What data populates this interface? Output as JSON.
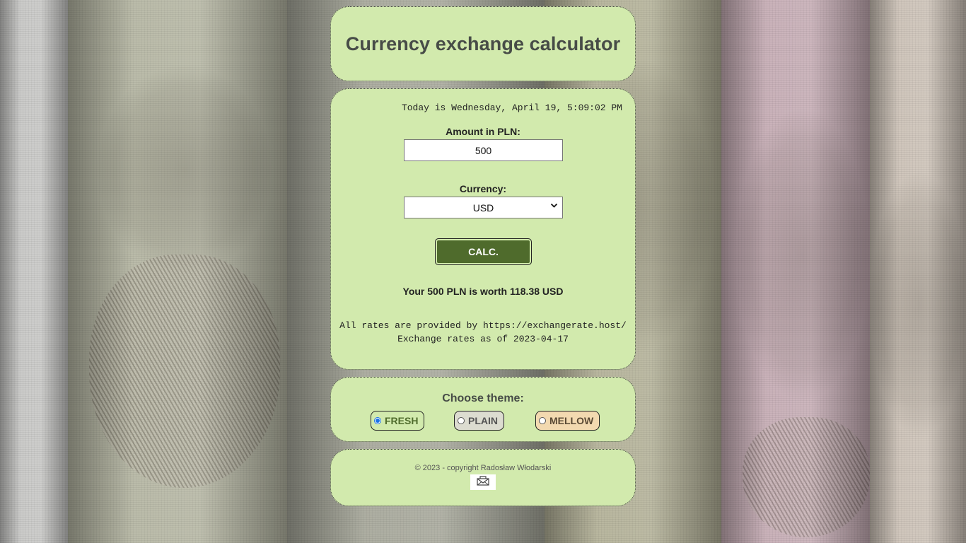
{
  "header": {
    "title": "Currency exchange calculator"
  },
  "calculator": {
    "date_line": "Today is Wednesday, April 19, 5:09:02 PM",
    "amount_label": "Amount in PLN:",
    "amount_value": "500",
    "currency_label": "Currency:",
    "currency_selected": "USD",
    "calc_label": "CALC.",
    "result_text": "Your 500 PLN is worth 118.38 USD",
    "rates_source": "All rates are provided by https://exchangerate.host/",
    "rates_date": "Exchange rates as of 2023-04-17"
  },
  "theme": {
    "title": "Choose theme:",
    "options": [
      {
        "label": "FRESH",
        "selected": true
      },
      {
        "label": "PLAIN",
        "selected": false
      },
      {
        "label": "MELLOW",
        "selected": false
      }
    ]
  },
  "footer": {
    "copyright": "© 2023 - copyright Radosław Włodarski",
    "mail_icon": "envelope-icon"
  },
  "colors": {
    "card_bg": "#d2eaad",
    "button_bg": "#4f6b2c",
    "title_text": "#474c47"
  }
}
